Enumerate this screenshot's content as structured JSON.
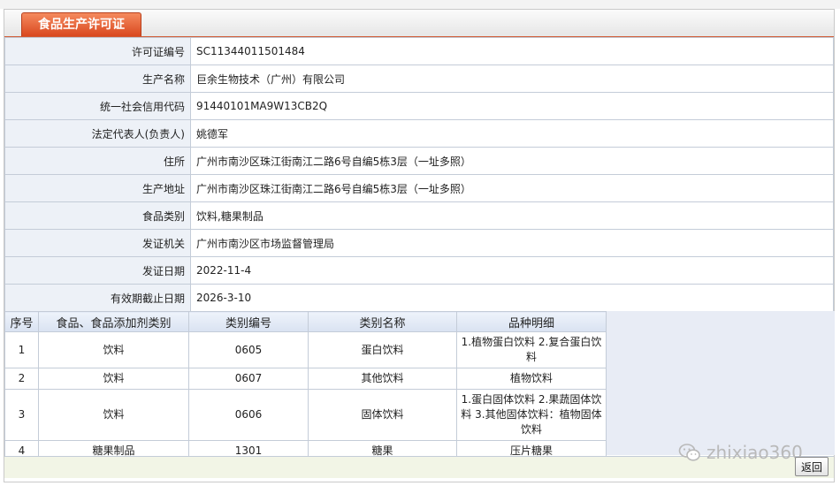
{
  "tab": {
    "title": "食品生产许可证"
  },
  "info_rows": [
    {
      "label": "许可证编号",
      "value": "SC11344011501484"
    },
    {
      "label": "生产名称",
      "value": "巨余生物技术（广州）有限公司"
    },
    {
      "label": "统一社会信用代码",
      "value": "91440101MA9W13CB2Q"
    },
    {
      "label": "法定代表人(负责人)",
      "value": "姚德军"
    },
    {
      "label": "住所",
      "value": "广州市南沙区珠江街南江二路6号自编5栋3层（一址多照）"
    },
    {
      "label": "生产地址",
      "value": "广州市南沙区珠江街南江二路6号自编5栋3层（一址多照）"
    },
    {
      "label": "食品类别",
      "value": "饮料,糖果制品"
    },
    {
      "label": "发证机关",
      "value": "广州市南沙区市场监督管理局"
    },
    {
      "label": "发证日期",
      "value": "2022-11-4"
    },
    {
      "label": "有效期截止日期",
      "value": "2026-3-10"
    }
  ],
  "category_table": {
    "headers": [
      "序号",
      "食品、食品添加剂类别",
      "类别编号",
      "类别名称",
      "品种明细"
    ],
    "rows": [
      {
        "no": "1",
        "type": "饮料",
        "code": "0605",
        "name": "蛋白饮料",
        "detail": "1.植物蛋白饮料 2.复合蛋白饮料"
      },
      {
        "no": "2",
        "type": "饮料",
        "code": "0607",
        "name": "其他饮料",
        "detail": "植物饮料"
      },
      {
        "no": "3",
        "type": "饮料",
        "code": "0606",
        "name": "固体饮料",
        "detail": "1.蛋白固体饮料 2.果蔬固体饮料 3.其他固体饮料：植物固体饮料"
      },
      {
        "no": "4",
        "type": "糖果制品",
        "code": "1301",
        "name": "糖果",
        "detail": "压片糖果"
      }
    ]
  },
  "footer": {
    "back_label": "返回"
  },
  "watermark": {
    "text": "zhixiao360",
    "icon": "wechat-icon"
  }
}
